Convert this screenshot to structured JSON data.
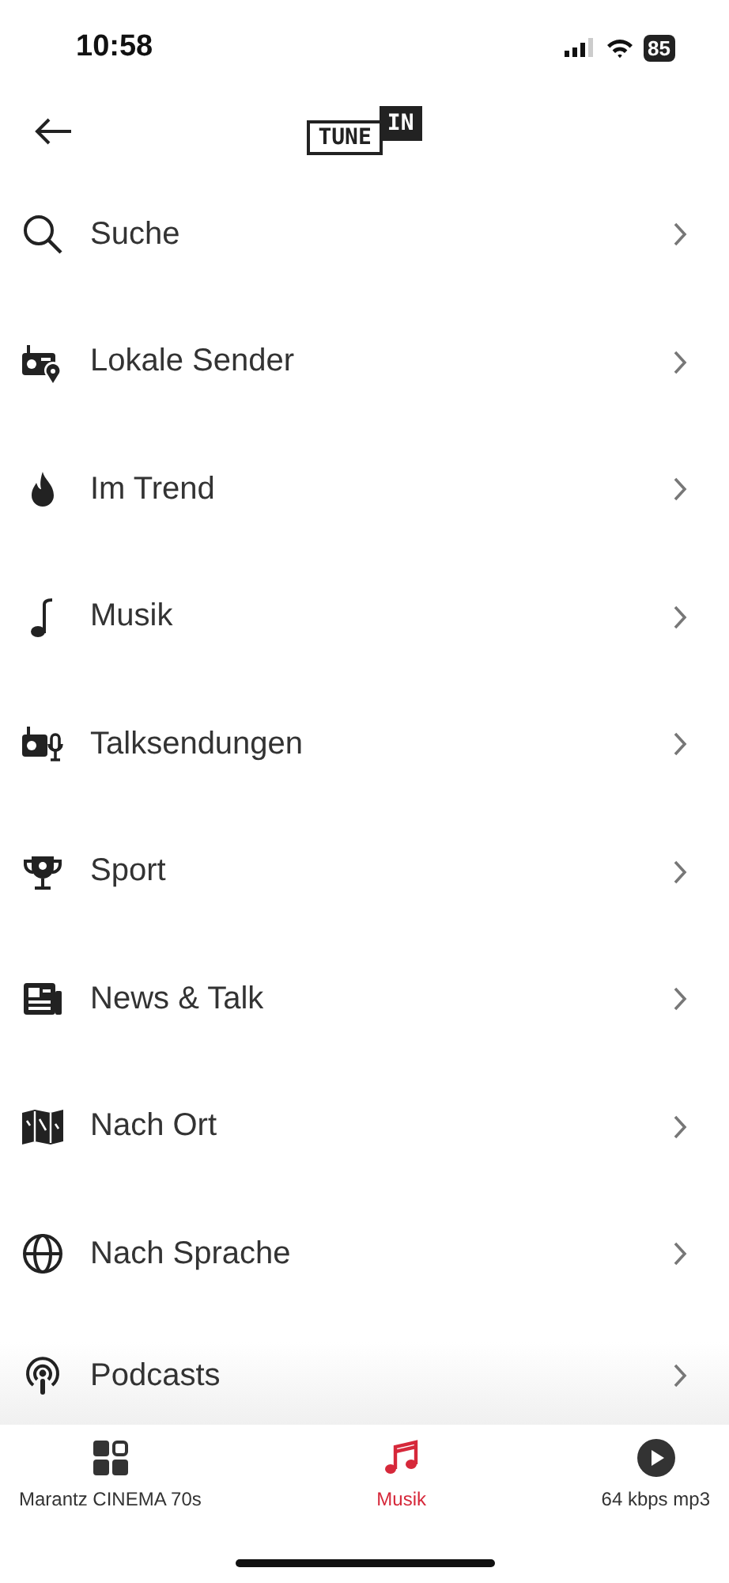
{
  "status_bar": {
    "time": "10:58",
    "battery": "85"
  },
  "header": {
    "logo_left": "TUNE",
    "logo_right": "IN"
  },
  "menu": [
    {
      "label": "Suche"
    },
    {
      "label": "Lokale Sender"
    },
    {
      "label": "Im Trend"
    },
    {
      "label": "Musik"
    },
    {
      "label": "Talksendungen"
    },
    {
      "label": "Sport"
    },
    {
      "label": "News & Talk"
    },
    {
      "label": "Nach Ort"
    },
    {
      "label": "Nach Sprache"
    },
    {
      "label": "Podcasts"
    }
  ],
  "tab_bar": [
    {
      "label": "Marantz CINEMA 70s",
      "selected": false
    },
    {
      "label": "Musik",
      "selected": true
    },
    {
      "label": "64 kbps mp3",
      "selected": false
    }
  ]
}
